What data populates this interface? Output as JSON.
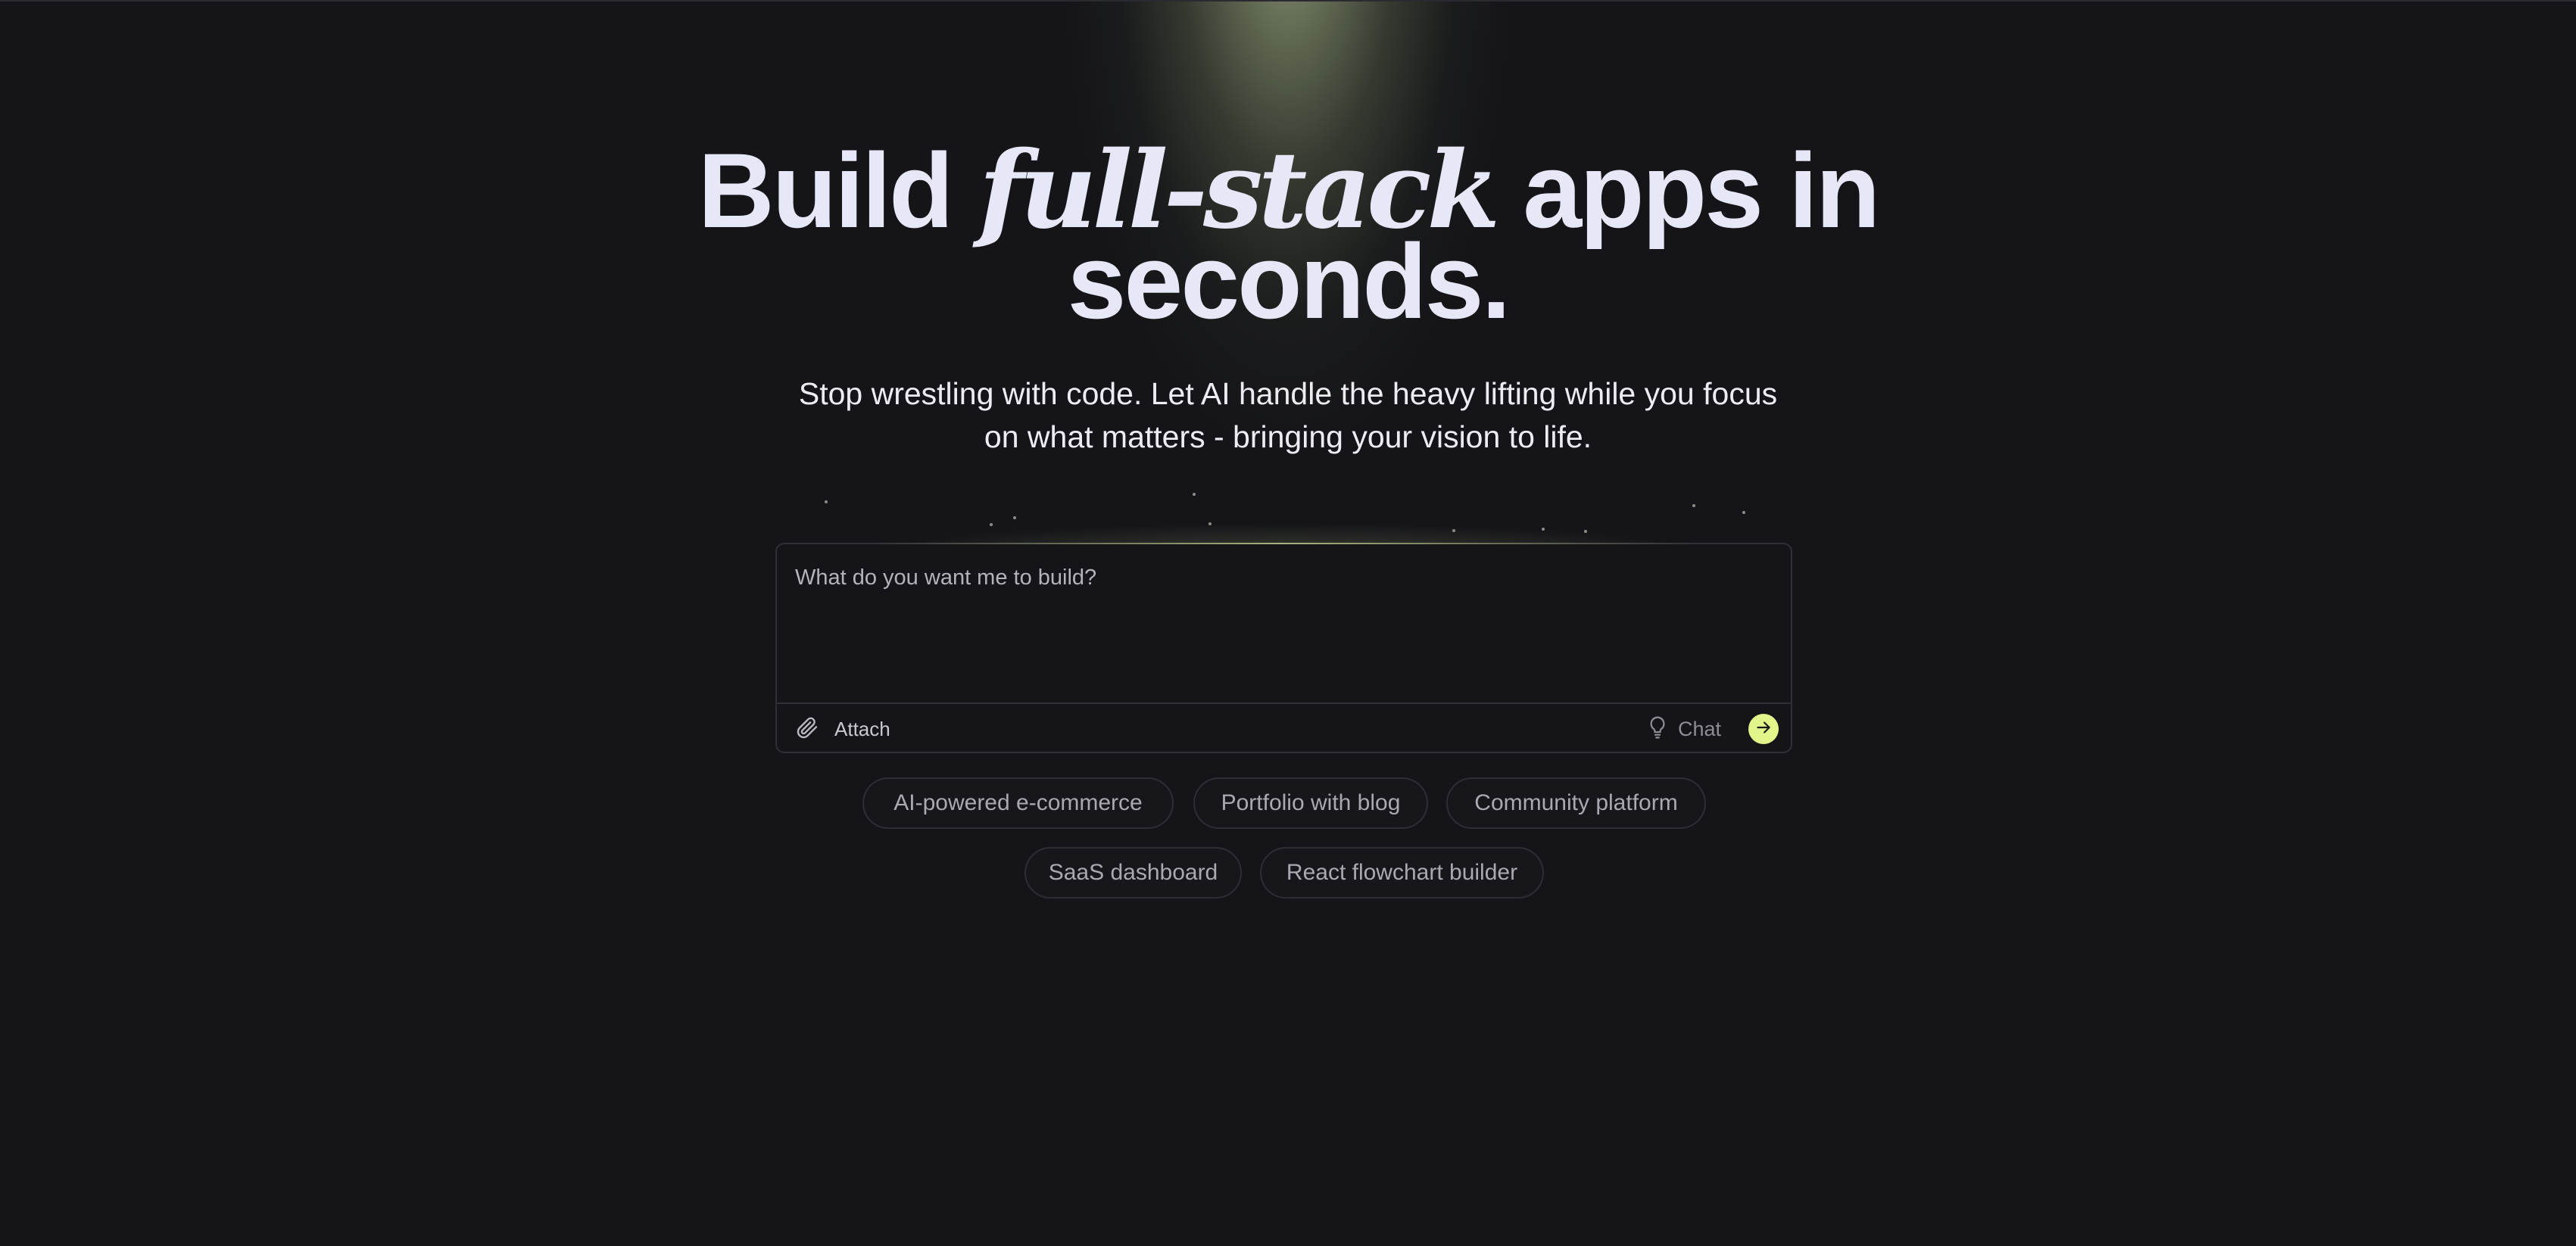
{
  "hero": {
    "title_part1": "Build ",
    "title_emphasis": "full-stack",
    "title_part2": " apps in",
    "title_line2": "seconds.",
    "subtitle_line1": "Stop wrestling with code. Let AI handle the heavy lifting while you focus",
    "subtitle_line2": "on what matters - bringing your vision to life."
  },
  "prompt": {
    "placeholder": "What do you want me to build?",
    "value": "",
    "attach_label": "Attach",
    "attach_icon": "paperclip-icon",
    "chat_label": "Chat",
    "chat_icon": "lightbulb-icon",
    "send_icon": "arrow-right-icon"
  },
  "suggestions": [
    "AI-powered e-commerce",
    "Portfolio with blog",
    "Community platform",
    "SaaS dashboard",
    "React flowchart builder"
  ],
  "colors": {
    "background": "#151519",
    "heading": "#e6e7f7",
    "accent": "#e2f58a",
    "glow": "#96a27d",
    "border": "#2f2f36"
  }
}
